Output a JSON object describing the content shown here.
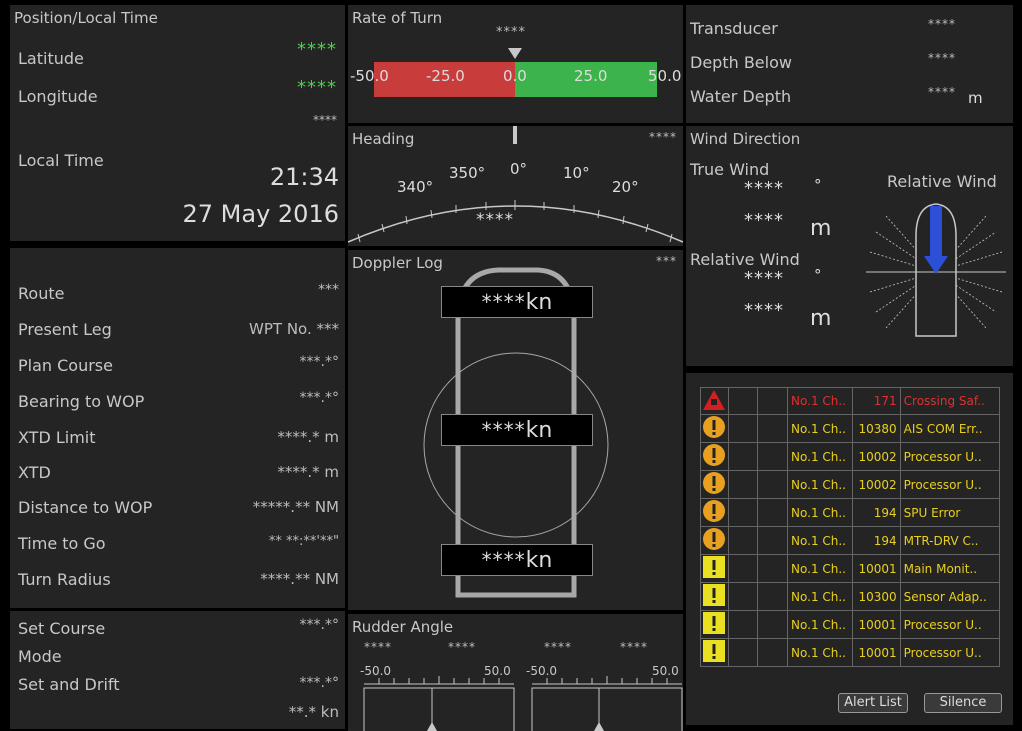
{
  "position": {
    "title": "Position/Local Time",
    "latitude_label": "Latitude",
    "latitude_value": "****",
    "longitude_label": "Longitude",
    "longitude_value": "****",
    "extra_value": "****",
    "local_time_label": "Local Time",
    "time": "21:34",
    "date": "27 May 2016"
  },
  "rot": {
    "title": "Rate of Turn",
    "value": "****",
    "ticks": [
      "-50.0",
      "-25.0",
      "0.0",
      "25.0",
      "50.0"
    ]
  },
  "heading": {
    "title": "Heading",
    "value_top": "****",
    "value_center": "****",
    "ticks": [
      "340°",
      "350°",
      "0°",
      "10°",
      "20°"
    ]
  },
  "depth": {
    "transducer_label": "Transducer",
    "transducer_value": "****",
    "depth_below_label": "Depth Below",
    "depth_below_value": "****",
    "water_depth_label": "Water Depth",
    "water_depth_value": "****",
    "water_depth_unit": "m"
  },
  "wind": {
    "title": "Wind Direction",
    "true_label": "True Wind",
    "true_dir_value": "****",
    "true_dir_unit": "°",
    "true_speed_value": "****",
    "true_speed_unit": "m",
    "relative_label": "Relative Wind",
    "relative_dir_value": "****",
    "relative_dir_unit": "°",
    "relative_speed_value": "****",
    "relative_speed_unit": "m",
    "graphic_label": "Relative Wind"
  },
  "route": {
    "items": [
      {
        "label": "Route",
        "value": "***"
      },
      {
        "label": "Present Leg",
        "value": "WPT No. ***"
      },
      {
        "label": "Plan Course",
        "value": "***.*°"
      },
      {
        "label": "Bearing to WOP",
        "value": "***.*°"
      },
      {
        "label": "XTD Limit",
        "value": "****.* m"
      },
      {
        "label": "XTD",
        "value": "****.* m"
      },
      {
        "label": "Distance to WOP",
        "value": "*****.** NM"
      },
      {
        "label": "Time to Go",
        "value": "** **:**'**\""
      },
      {
        "label": "Turn Radius",
        "value": "****.** NM"
      }
    ],
    "set_course_label": "Set Course",
    "set_course_value": "***.*°",
    "mode_label": "Mode",
    "set_drift_label": "Set and Drift",
    "set_drift_value_1": "***.*°",
    "set_drift_value_2": "**.* kn"
  },
  "doppler": {
    "title": "Doppler Log",
    "status": "***",
    "bow_value": "****",
    "mid_value": "****",
    "stern_value": "****",
    "unit": "kn"
  },
  "rudder": {
    "title": "Rudder Angle",
    "values": [
      "****",
      "****",
      "****",
      "****"
    ],
    "left_min": "-50.0",
    "left_max": "50.0",
    "right_min": "-50.0",
    "right_max": "50.0"
  },
  "alerts": {
    "rows": [
      {
        "icon": "red-triangle",
        "source": "No.1 Ch..",
        "id": "171",
        "text": "Crossing Saf..",
        "color": "#e03030"
      },
      {
        "icon": "orange-circle",
        "source": "No.1 Ch..",
        "id": "10380",
        "text": "AIS COM Err..",
        "color": "#e8d020"
      },
      {
        "icon": "orange-circle",
        "source": "No.1 Ch..",
        "id": "10002",
        "text": "Processor U..",
        "color": "#e8d020"
      },
      {
        "icon": "orange-circle",
        "source": "No.1 Ch..",
        "id": "10002",
        "text": "Processor U..",
        "color": "#e8d020"
      },
      {
        "icon": "orange-circle",
        "source": "No.1 Ch..",
        "id": "194",
        "text": "SPU Error",
        "color": "#e8d020"
      },
      {
        "icon": "orange-circle",
        "source": "No.1 Ch..",
        "id": "194",
        "text": "MTR-DRV C..",
        "color": "#e8d020"
      },
      {
        "icon": "yellow-square",
        "source": "No.1 Ch..",
        "id": "10001",
        "text": "Main Monit..",
        "color": "#e8d020"
      },
      {
        "icon": "yellow-square",
        "source": "No.1 Ch..",
        "id": "10300",
        "text": "Sensor Adap..",
        "color": "#e8d020"
      },
      {
        "icon": "yellow-square",
        "source": "No.1 Ch..",
        "id": "10001",
        "text": "Processor U..",
        "color": "#e8d020"
      },
      {
        "icon": "yellow-square",
        "source": "No.1 Ch..",
        "id": "10001",
        "text": "Processor U..",
        "color": "#e8d020"
      }
    ],
    "alert_list_label": "Alert List",
    "silence_label": "Silence"
  },
  "colors": {
    "panel": "#242424",
    "green_text": "#4cd24c",
    "rot_red": "#c83c3c",
    "rot_green": "#3cb44b",
    "wind_arrow": "#2b4fd6"
  }
}
